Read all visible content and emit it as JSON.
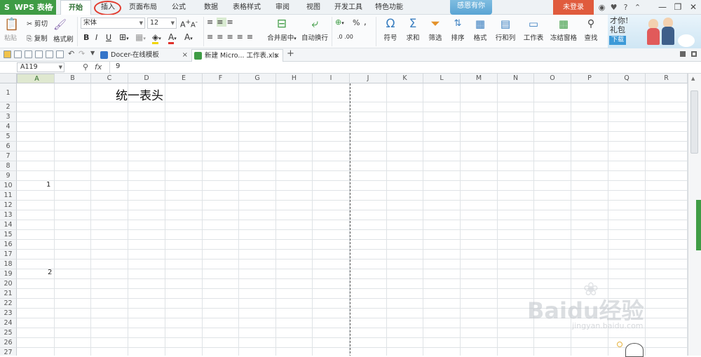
{
  "app": {
    "name": "WPS 表格",
    "logo": "S"
  },
  "ribbon_tabs": [
    "开始",
    "插入",
    "页面布局",
    "公式",
    "数据",
    "表格样式",
    "审阅",
    "视图",
    "开发工具",
    "特色功能"
  ],
  "thanks_text": "感恩有你",
  "login_label": "未登录",
  "clipboard": {
    "paste": "粘贴",
    "cut": "剪切",
    "copy": "复制",
    "format_painter": "格式刷"
  },
  "font": {
    "name": "宋体",
    "size": "12",
    "bold": "B",
    "italic": "I",
    "underline": "U"
  },
  "align": {
    "merge": "合并居中",
    "wrap": "自动换行"
  },
  "number": {
    "percent": "%",
    "comma": ","
  },
  "tools": {
    "symbol": "符号",
    "sum": "求和",
    "filter": "筛选",
    "sort": "排序",
    "format": "格式",
    "rowcol": "行和列",
    "sheet": "工作表",
    "freeze": "冻结窗格",
    "find": "查找"
  },
  "banner": {
    "line1": "才你!",
    "line2": "礼包",
    "download": "下载"
  },
  "doc_tabs": [
    {
      "label": "Docer-在线模板",
      "close": "×"
    },
    {
      "label": "新建 Micro... 工作表.xls",
      "close": "×"
    }
  ],
  "new_tab": "+",
  "formula_bar": {
    "name_box": "A119",
    "fx": "fx",
    "value": "9"
  },
  "columns": [
    "A",
    "B",
    "C",
    "D",
    "E",
    "F",
    "G",
    "H",
    "I",
    "J",
    "K",
    "L",
    "M",
    "N",
    "O",
    "P",
    "Q",
    "R"
  ],
  "rows": [
    "1",
    "2",
    "3",
    "4",
    "5",
    "6",
    "7",
    "8",
    "9",
    "10",
    "11",
    "12",
    "13",
    "14",
    "15",
    "16",
    "17",
    "18",
    "19",
    "20",
    "21",
    "22",
    "23",
    "24",
    "25",
    "26",
    "27"
  ],
  "cells": {
    "header_title": "统一表头",
    "a10": "1",
    "a19": "2"
  },
  "watermark": {
    "brand": "Baidu经验",
    "url": "jingyan.baidu.com"
  },
  "colors": {
    "accent_green": "#3f9c45",
    "login_red": "#e05b3d",
    "annotation_red": "#e23b2e"
  }
}
